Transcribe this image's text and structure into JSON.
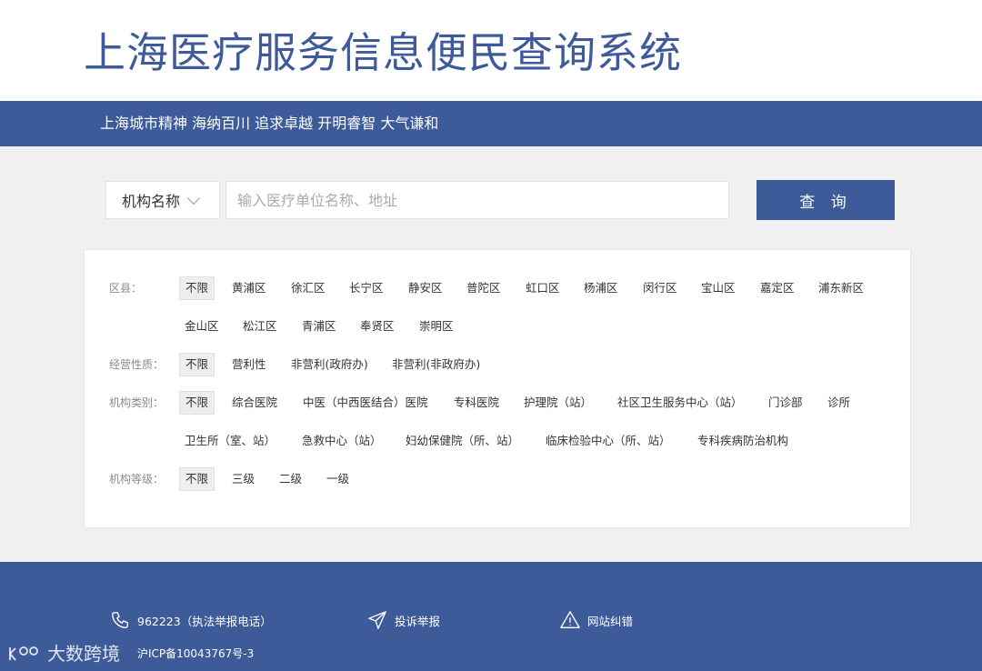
{
  "header": {
    "title": "上海医疗服务信息便民查询系统",
    "slogan": "上海城市精神 海纳百川 追求卓越 开明睿智 大气谦和"
  },
  "search": {
    "type_selected": "机构名称",
    "placeholder": "输入医疗单位名称、地址",
    "button_label": "查 询"
  },
  "filters": {
    "district": {
      "label": "区县：",
      "options": [
        "不限",
        "黄浦区",
        "徐汇区",
        "长宁区",
        "静安区",
        "普陀区",
        "虹口区",
        "杨浦区",
        "闵行区",
        "宝山区",
        "嘉定区",
        "浦东新区",
        "金山区",
        "松江区",
        "青浦区",
        "奉贤区",
        "崇明区"
      ]
    },
    "nature": {
      "label": "经营性质：",
      "options": [
        "不限",
        "营利性",
        "非营利(政府办)",
        "非营利(非政府办)"
      ]
    },
    "category": {
      "label": "机构类别：",
      "options": [
        "不限",
        "综合医院",
        "中医（中西医结合）医院",
        "专科医院",
        "护理院（站）",
        "社区卫生服务中心（站）",
        "门诊部",
        "诊所",
        "卫生所（室、站）",
        "急救中心（站）",
        "妇幼保健院（所、站）",
        "临床检验中心（所、站）",
        "专科疾病防治机构"
      ]
    },
    "level": {
      "label": "机构等级：",
      "options": [
        "不限",
        "三级",
        "二级",
        "一级"
      ]
    }
  },
  "footer": {
    "hotline": "962223（执法举报电话）",
    "complaint": "投诉举报",
    "correction": "网站纠错",
    "icp": "沪ICP备10043767号-3",
    "watermark": "大数跨境"
  },
  "colors": {
    "brand_blue": "#3d5a99",
    "title_blue": "#3f5a9b",
    "page_bg": "#f0f0f0"
  }
}
